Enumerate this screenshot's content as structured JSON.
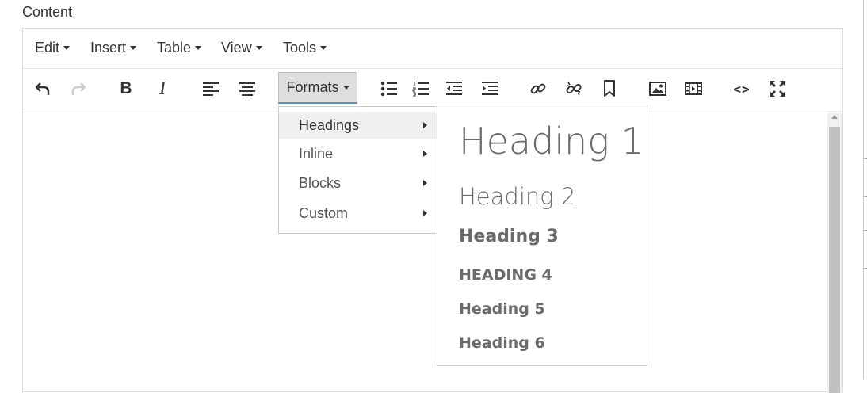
{
  "field": {
    "label": "Content"
  },
  "menubar": {
    "items": [
      {
        "label": "Edit"
      },
      {
        "label": "Insert"
      },
      {
        "label": "Table"
      },
      {
        "label": "View"
      },
      {
        "label": "Tools"
      }
    ]
  },
  "toolbar": {
    "formats_label": "Formats",
    "bold_glyph": "B",
    "italic_glyph": "I",
    "code_glyph": "<>",
    "icons": [
      "undo-icon",
      "redo-icon",
      "bold-icon",
      "italic-icon",
      "align-left-icon",
      "align-center-icon",
      "bullet-list-icon",
      "numbered-list-icon",
      "outdent-icon",
      "indent-icon",
      "link-icon",
      "unlink-icon",
      "bookmark-icon",
      "image-icon",
      "media-icon",
      "source-code-icon",
      "fullscreen-icon"
    ]
  },
  "formats_menu": {
    "items": [
      {
        "label": "Headings"
      },
      {
        "label": "Inline"
      },
      {
        "label": "Blocks"
      },
      {
        "label": "Custom"
      }
    ]
  },
  "headings_menu": {
    "items": [
      {
        "label": "Heading 1"
      },
      {
        "label": "Heading 2"
      },
      {
        "label": "Heading 3"
      },
      {
        "label": "HEADING 4"
      },
      {
        "label": "Heading 5"
      },
      {
        "label": "Heading 6"
      }
    ]
  },
  "colors": {
    "accent": "#5b8fc9",
    "text": "#333333",
    "heading": "#6b6b6b"
  }
}
